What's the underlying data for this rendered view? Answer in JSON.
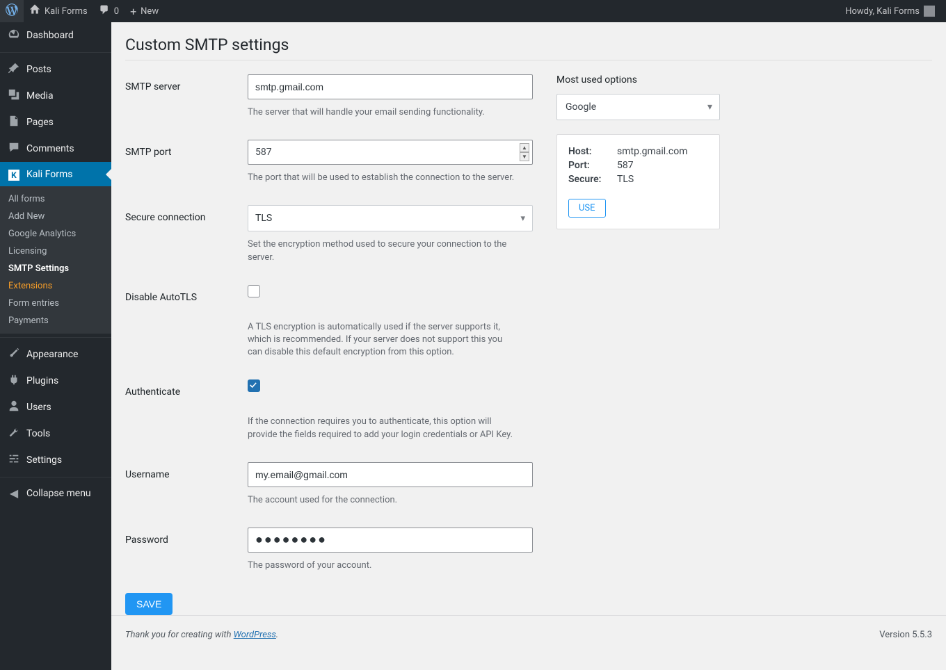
{
  "adminbar": {
    "site_name": "Kali Forms",
    "comments_count": "0",
    "new_label": "New",
    "greeting": "Howdy, Kali Forms"
  },
  "sidebar": {
    "dashboard": "Dashboard",
    "posts": "Posts",
    "media": "Media",
    "pages": "Pages",
    "comments": "Comments",
    "kaliforms": "Kali Forms",
    "sub_all_forms": "All forms",
    "sub_add_new": "Add New",
    "sub_google_analytics": "Google Analytics",
    "sub_licensing": "Licensing",
    "sub_smtp_settings": "SMTP Settings",
    "sub_extensions": "Extensions",
    "sub_form_entries": "Form entries",
    "sub_payments": "Payments",
    "appearance": "Appearance",
    "plugins": "Plugins",
    "users": "Users",
    "tools": "Tools",
    "settings": "Settings",
    "collapse": "Collapse menu"
  },
  "page": {
    "title": "Custom SMTP settings"
  },
  "form": {
    "smtp_server_label": "SMTP server",
    "smtp_server_value": "smtp.gmail.com",
    "smtp_server_help": "The server that will handle your email sending functionality.",
    "smtp_port_label": "SMTP port",
    "smtp_port_value": "587",
    "smtp_port_help": "The port that will be used to establish the connection to the server.",
    "secure_label": "Secure connection",
    "secure_value": "TLS",
    "secure_help": "Set the encryption method used to secure your connection to the server.",
    "disable_autotls_label": "Disable AutoTLS",
    "disable_autotls_help": "A TLS encryption is automatically used if the server supports it, which is recommended. If your server does not support this you can disable this default encryption from this option.",
    "authenticate_label": "Authenticate",
    "authenticate_help": "If the connection requires you to authenticate, this option will provide the fields required to add your login credentials or API Key.",
    "username_label": "Username",
    "username_value": "my.email@gmail.com",
    "username_help": "The account used for the connection.",
    "password_label": "Password",
    "password_value": "●●●●●●●●",
    "password_help": "The password of your account.",
    "save_button": "SAVE"
  },
  "side": {
    "title": "Most used options",
    "select_value": "Google",
    "host_label": "Host:",
    "host_value": "smtp.gmail.com",
    "port_label": "Port:",
    "port_value": "587",
    "secure_label": "Secure:",
    "secure_value": "TLS",
    "use_button": "USE"
  },
  "footer": {
    "thanks_prefix": "Thank you for creating with ",
    "wp_link": "WordPress",
    "thanks_suffix": ".",
    "version": "Version 5.5.3"
  }
}
